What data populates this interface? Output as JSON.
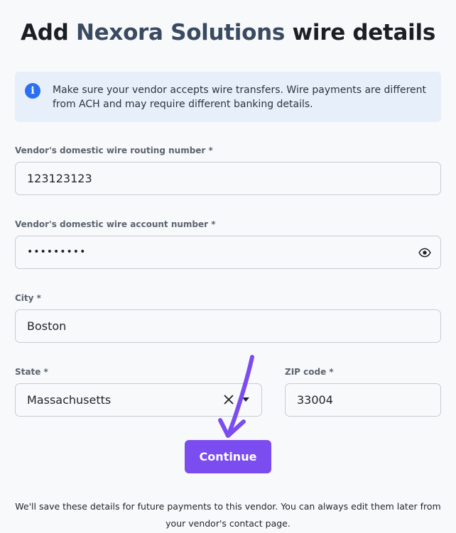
{
  "title": {
    "prefix": "Add",
    "vendor_name": "Nexora Solutions",
    "suffix": "wire details"
  },
  "info": {
    "icon": "info-icon",
    "text": "Make sure your vendor accepts wire transfers. Wire payments are different from ACH and may require different banking details."
  },
  "form": {
    "routing": {
      "label": "Vendor's domestic wire routing number *",
      "value": "123123123"
    },
    "account": {
      "label": "Vendor's domestic wire account number *",
      "value": "•••••••••",
      "reveal_icon": "eye-icon"
    },
    "city": {
      "label": "City *",
      "value": "Boston"
    },
    "state": {
      "label": "State *",
      "value": "Massachusetts",
      "clear_icon": "close-icon",
      "dropdown_icon": "chevron-down-icon"
    },
    "zip": {
      "label": "ZIP code *",
      "value": "33004"
    }
  },
  "continue_label": "Continue",
  "footer": "We'll save these details for future payments to this vendor. You can always edit them later from your vendor's contact page.",
  "colors": {
    "accent": "#7b4cf0",
    "info_bg": "#e7effb",
    "info_icon": "#2d6ff0",
    "annotation_arrow": "#7b4cf0"
  }
}
